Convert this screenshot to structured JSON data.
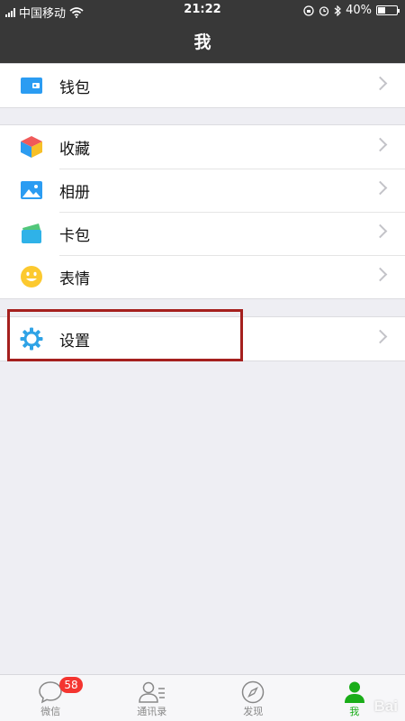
{
  "status_bar": {
    "carrier": "中国移动",
    "time": "21:22",
    "battery_percent": "40%",
    "battery_level": 0.4,
    "icons": [
      "signal-icon",
      "wifi-icon",
      "lock-rotation-icon",
      "alarm-icon",
      "bluetooth-icon",
      "battery-icon"
    ]
  },
  "navbar": {
    "title": "我"
  },
  "menu": {
    "wallet": {
      "label": "钱包",
      "icon": "wallet-icon"
    },
    "favorites": {
      "label": "收藏",
      "icon": "cube-icon"
    },
    "album": {
      "label": "相册",
      "icon": "photo-icon"
    },
    "cards": {
      "label": "卡包",
      "icon": "card-icon"
    },
    "stickers": {
      "label": "表情",
      "icon": "smiley-icon"
    },
    "settings": {
      "label": "设置",
      "icon": "gear-icon"
    }
  },
  "tabbar": {
    "tabs": [
      {
        "label": "微信",
        "icon": "chat-icon",
        "badge": "58"
      },
      {
        "label": "通讯录",
        "icon": "contacts-icon"
      },
      {
        "label": "发现",
        "icon": "compass-icon"
      },
      {
        "label": "我",
        "icon": "person-icon",
        "active": true
      }
    ]
  },
  "watermark": "Bai",
  "colors": {
    "accent": "#1aad19",
    "navbar": "#383838",
    "badge": "#f43530",
    "highlight": "#a5201e",
    "background": "#eeeef3"
  }
}
